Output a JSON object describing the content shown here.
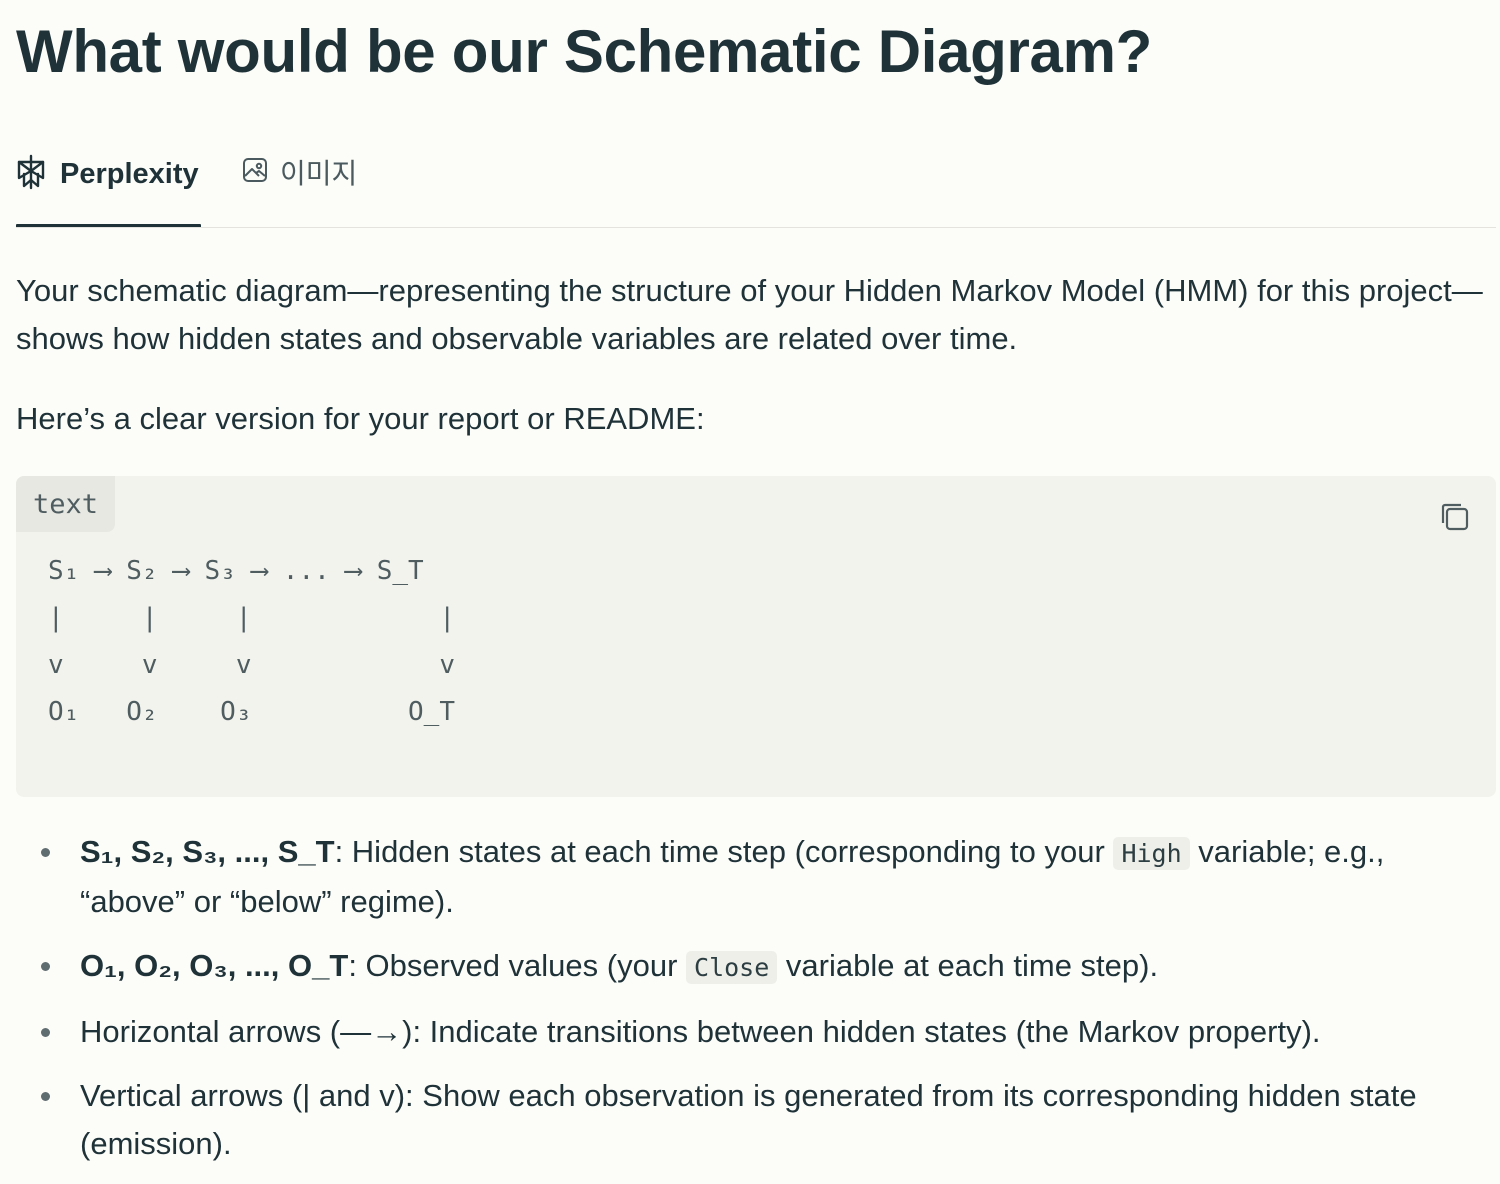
{
  "title": "What would be our Schematic Diagram?",
  "tabs": [
    {
      "label": "Perplexity",
      "icon": "perplexity-logo-icon",
      "active": true
    },
    {
      "label": "이미지",
      "icon": "image-icon",
      "active": false
    }
  ],
  "answer": {
    "intro": "Your schematic diagram—representing the structure of your Hidden Markov Model (HMM) for this project—shows how hidden states and observable variables are related over time.",
    "lead": "Here’s a clear version for your report or README:",
    "code_block": {
      "language": "text",
      "copy_icon": "copy-icon",
      "content": "S₁ ⟶ S₂ ⟶ S₃ ⟶ ... ⟶ S_T\n|     |     |            |\nv     v     v            v\nO₁   O₂    O₃          O_T"
    },
    "bullets": [
      {
        "term": "S₁, S₂, S₃, ..., S_T",
        "text_before": ": Hidden states at each time step (corresponding to your ",
        "code": "High",
        "text_after": " variable; e.g., “above” or “below” regime)."
      },
      {
        "term": "O₁, O₂, O₃, ..., O_T",
        "text_before": ": Observed values (your ",
        "code": "Close",
        "text_after": " variable at each time step)."
      },
      {
        "text": "Horizontal arrows (—→): Indicate transitions between hidden states (the Markov property)."
      },
      {
        "text": "Vertical arrows (| and v): Show each observation is generated from its corresponding hidden state (emission)."
      }
    ]
  },
  "colors": {
    "text": "#1e3238",
    "background": "#fcfcf9",
    "code_background": "#f3f3ee"
  }
}
